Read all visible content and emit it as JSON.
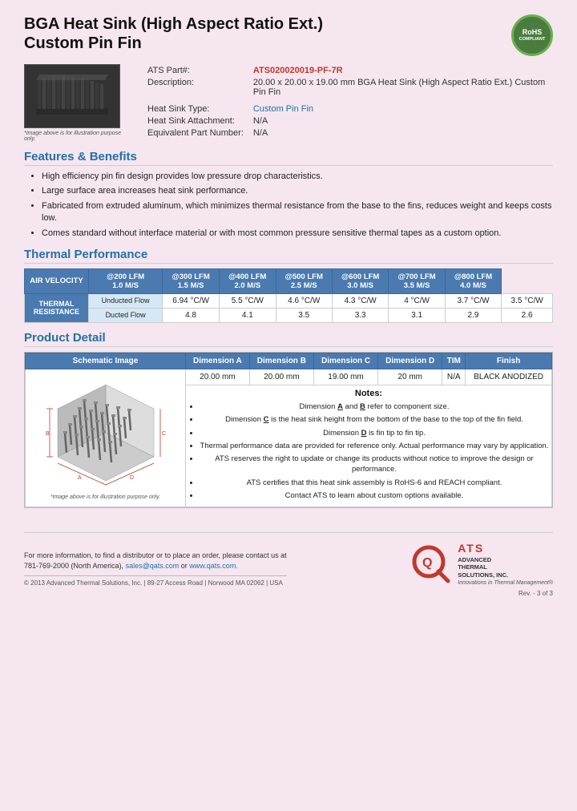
{
  "header": {
    "title_line1": "BGA Heat Sink (High Aspect Ratio Ext.)",
    "title_line2": "Custom Pin Fin",
    "rohs": {
      "line1": "RoHS",
      "line2": "COMPLIANT"
    }
  },
  "part_info": {
    "ats_part_label": "ATS Part#:",
    "ats_part_value": "ATS020020019-PF-7R",
    "description_label": "Description:",
    "description_value": "20.00 x 20.00 x 19.00 mm  BGA Heat Sink (High Aspect Ratio Ext.) Custom Pin Fin",
    "heat_sink_type_label": "Heat Sink Type:",
    "heat_sink_type_value": "Custom Pin Fin",
    "heat_sink_attachment_label": "Heat Sink Attachment:",
    "heat_sink_attachment_value": "N/A",
    "equivalent_part_label": "Equivalent Part Number:",
    "equivalent_part_value": "N/A"
  },
  "image_caption": "*Image above is for illustration purpose only.",
  "features_benefits": {
    "title": "Features & Benefits",
    "items": [
      "High efficiency pin fin design provides low pressure drop characteristics.",
      "Large surface area increases heat sink performance.",
      "Fabricated from extruded aluminum, which minimizes thermal resistance from the base to the fins, reduces weight and keeps costs low.",
      "Comes standard without interface material or with most common pressure sensitive thermal tapes as a custom option."
    ]
  },
  "thermal_performance": {
    "title": "Thermal Performance",
    "table": {
      "col_header_label": "AIR VELOCITY",
      "columns": [
        {
          "line1": "@200 LFM",
          "line2": "1.0 M/S"
        },
        {
          "line1": "@300 LFM",
          "line2": "1.5 M/S"
        },
        {
          "line1": "@400 LFM",
          "line2": "2.0 M/S"
        },
        {
          "line1": "@500 LFM",
          "line2": "2.5 M/S"
        },
        {
          "line1": "@600 LFM",
          "line2": "3.0 M/S"
        },
        {
          "line1": "@700 LFM",
          "line2": "3.5 M/S"
        },
        {
          "line1": "@800 LFM",
          "line2": "4.0 M/S"
        }
      ],
      "row_header": "THERMAL RESISTANCE",
      "rows": [
        {
          "label": "Unducted Flow",
          "values": [
            "6.94 °C/W",
            "5.5 °C/W",
            "4.6 °C/W",
            "4.3 °C/W",
            "4 °C/W",
            "3.7 °C/W",
            "3.5 °C/W"
          ]
        },
        {
          "label": "Ducted Flow",
          "values": [
            "4.8",
            "4.1",
            "3.5",
            "3.3",
            "3.1",
            "2.9",
            "2.6"
          ]
        }
      ]
    }
  },
  "product_detail": {
    "title": "Product Detail",
    "table": {
      "headers": [
        "Schematic Image",
        "Dimension A",
        "Dimension B",
        "Dimension C",
        "Dimension D",
        "TIM",
        "Finish"
      ],
      "values": [
        "20.00 mm",
        "20.00 mm",
        "19.00 mm",
        "20 mm",
        "N/A",
        "BLACK ANODIZED"
      ]
    },
    "schematic_caption": "*Image above is for illustration purpose only.",
    "notes": {
      "title": "Notes:",
      "items": [
        "Dimension A and B refer to component size.",
        "Dimension C is the heat sink height from the bottom of the base to the top of the fin field.",
        "Dimension D is fin tip to fin tip.",
        "Thermal performance data are provided for reference only. Actual performance may vary by application.",
        "ATS reserves the right to update or change its products without notice to improve the design or performance.",
        "ATS certifies that this heat sink assembly is RoHS-6 and REACH compliant.",
        "Contact ATS to learn about custom options available."
      ]
    }
  },
  "footer": {
    "contact_text": "For more information, to find a distributor or to place an order, please contact us at",
    "phone": "781-769-2000 (North America),",
    "email": "sales@qats.com",
    "email_connector": "or",
    "website": "www.qats.com.",
    "copyright": "© 2013 Advanced Thermal Solutions, Inc.  |  89-27 Access Road  |  Norwood MA  02062  |  USA",
    "ats_name_line1": "ADVANCED",
    "ats_name_line2": "THERMAL",
    "ats_name_line3": "SOLUTIONS, INC.",
    "ats_tagline": "Innovations in Thermal Management®",
    "page_num": "Rev. - 3 of 3"
  }
}
